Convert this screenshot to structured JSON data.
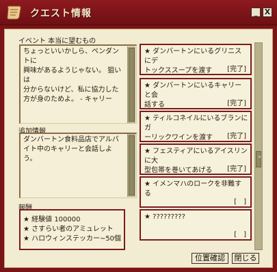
{
  "window": {
    "title": "クエスト情報",
    "minimize_label": "_",
    "close_label": "X"
  },
  "quest": {
    "name": "イベント 本当に望むもの",
    "description": "ちょっといいかしら、ペンダントに\n興味があるようじゃない。 狙いは\n分からないけど、私に協力した\n方が身のためよ。 - キャリー",
    "info_label": "追加情報",
    "info_text": "ダンバートン食料品店でアルバ\nイト中のキャリーと会話しよう。",
    "reward_label": "報酬",
    "rewards": [
      "★ 経験値 100000",
      "★ さすらい者のアミュレット",
      "★ ハロウィンステッカー~50個"
    ]
  },
  "objectives": [
    {
      "text": "★ ダンバートンにいるグリニスにデ\nトックススープを渡す",
      "status": "[完了]"
    },
    {
      "text": "★ ダンバートンにいるキャリーと会\n話する",
      "status": "[完了]"
    },
    {
      "text": "★ ティルコネイルにいるブランにガ\nーリックワインを渡す",
      "status": "[完了]"
    },
    {
      "text": "★ フェスティアにいるアイスリンに大\n型包帯を巻いてあげる",
      "status": "[完了]"
    },
    {
      "text": "★ イメンマハのロークを非難する",
      "status": "[　]"
    },
    {
      "text": "★ ?????????",
      "status": "[　]"
    }
  ],
  "buttons": {
    "locate": "位置確認",
    "close": "閉じる"
  },
  "colors": {
    "frame": "#7a1418",
    "panel_bg": "#f1ecd2",
    "card_border": "#7a1a1f",
    "title_text": "#f6e8c8"
  }
}
